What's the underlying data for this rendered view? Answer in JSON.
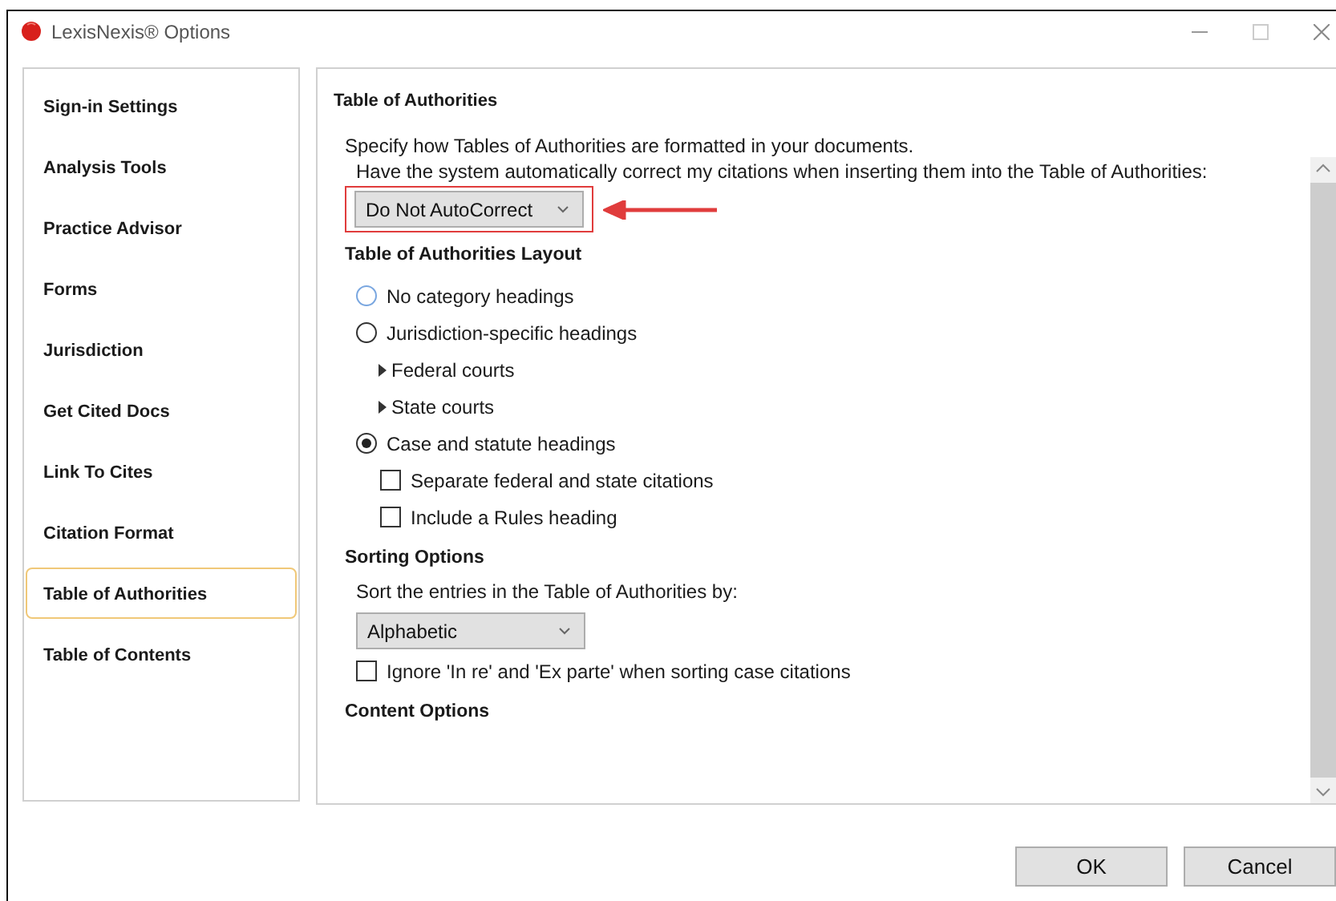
{
  "window": {
    "title": "LexisNexis® Options"
  },
  "sidebar": {
    "items": [
      {
        "label": "Sign-in Settings",
        "selected": false
      },
      {
        "label": "Analysis Tools",
        "selected": false
      },
      {
        "label": "Practice Advisor",
        "selected": false
      },
      {
        "label": "Forms",
        "selected": false
      },
      {
        "label": "Jurisdiction",
        "selected": false
      },
      {
        "label": "Get Cited Docs",
        "selected": false
      },
      {
        "label": "Link To Cites",
        "selected": false
      },
      {
        "label": "Citation Format",
        "selected": false
      },
      {
        "label": "Table of Authorities",
        "selected": true
      },
      {
        "label": "Table of Contents",
        "selected": false
      }
    ]
  },
  "panel": {
    "title": "Table of Authorities",
    "description": "Specify how Tables of Authorities are formatted in your documents.",
    "autocorrect": {
      "label": "Have the system automatically correct my citations when inserting them into the Table of Authorities:",
      "value": "Do Not AutoCorrect"
    },
    "layout": {
      "heading": "Table of Authorities Layout",
      "options": [
        {
          "kind": "radio",
          "label": "No category headings",
          "selected": false
        },
        {
          "kind": "radio",
          "label": "Jurisdiction-specific headings",
          "selected": false
        },
        {
          "kind": "expander",
          "label": "Federal courts",
          "expanded": false
        },
        {
          "kind": "expander",
          "label": "State courts",
          "expanded": false
        },
        {
          "kind": "radio",
          "label": "Case and statute headings",
          "selected": true
        },
        {
          "kind": "checkbox",
          "label": "Separate federal and state citations",
          "checked": false
        },
        {
          "kind": "checkbox",
          "label": "Include a Rules heading",
          "checked": false
        }
      ]
    },
    "sorting": {
      "heading": "Sorting Options",
      "label": "Sort the entries in the Table of Authorities by:",
      "value": "Alphabetic",
      "options": [
        {
          "label": "Ignore 'In re' and 'Ex parte' when sorting case citations",
          "checked": false
        }
      ]
    },
    "content": {
      "heading": "Content Options"
    }
  },
  "buttons": [
    {
      "label": "OK"
    },
    {
      "label": "Cancel"
    }
  ]
}
